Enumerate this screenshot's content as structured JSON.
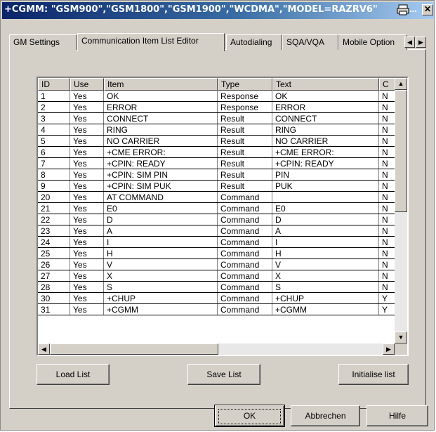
{
  "window": {
    "title": "+CGMM: \"GSM900\",\"GSM1800\",\"GSM1900\",\"WCDMA\",\"MODEL=RAZRV6\"",
    "title_ellipsis": "...",
    "close_glyph": "✕"
  },
  "tabs": [
    {
      "label": "GM Settings"
    },
    {
      "label": "Communication Item List Editor"
    },
    {
      "label": "Autodialing"
    },
    {
      "label": "SQA/VQA"
    },
    {
      "label": "Mobile Option"
    }
  ],
  "active_tab": "Communication Item List Editor",
  "table": {
    "columns": [
      "ID",
      "Use",
      "Item",
      "Type",
      "Text",
      "C"
    ],
    "rows": [
      [
        "1",
        "Yes",
        "OK",
        "Response",
        "OK",
        "N"
      ],
      [
        "2",
        "Yes",
        "ERROR",
        "Response",
        "ERROR",
        "N"
      ],
      [
        "3",
        "Yes",
        "CONNECT",
        "Result",
        "CONNECT",
        "N"
      ],
      [
        "4",
        "Yes",
        "RING",
        "Result",
        "RING",
        "N"
      ],
      [
        "5",
        "Yes",
        "NO CARRIER",
        "Result",
        "NO CARRIER",
        "N"
      ],
      [
        "6",
        "Yes",
        "+CME ERROR:",
        "Result",
        "+CME ERROR:",
        "N"
      ],
      [
        "7",
        "Yes",
        "+CPIN: READY",
        "Result",
        "+CPIN: READY",
        "N"
      ],
      [
        "8",
        "Yes",
        "+CPIN: SIM PIN",
        "Result",
        "PIN",
        "N"
      ],
      [
        "9",
        "Yes",
        "+CPIN: SIM PUK",
        "Result",
        "PUK",
        "N"
      ],
      [
        "20",
        "Yes",
        "AT COMMAND",
        "Command",
        "",
        "N"
      ],
      [
        "21",
        "Yes",
        "E0",
        "Command",
        "E0",
        "N"
      ],
      [
        "22",
        "Yes",
        "D",
        "Command",
        "D",
        "N"
      ],
      [
        "23",
        "Yes",
        "A",
        "Command",
        "A",
        "N"
      ],
      [
        "24",
        "Yes",
        "I",
        "Command",
        "I",
        "N"
      ],
      [
        "25",
        "Yes",
        "H",
        "Command",
        "H",
        "N"
      ],
      [
        "26",
        "Yes",
        "V",
        "Command",
        "V",
        "N"
      ],
      [
        "27",
        "Yes",
        "X",
        "Command",
        "X",
        "N"
      ],
      [
        "28",
        "Yes",
        "S",
        "Command",
        "S",
        "N"
      ],
      [
        "30",
        "Yes",
        "+CHUP",
        "Command",
        "+CHUP",
        "Y"
      ],
      [
        "31",
        "Yes",
        "+CGMM",
        "Command",
        "+CGMM",
        "Y"
      ]
    ]
  },
  "buttons": {
    "load": "Load List",
    "save": "Save List",
    "init": "Initialise list",
    "ok": "OK",
    "cancel": "Abbrechen",
    "help": "Hilfe"
  },
  "scroll_glyphs": {
    "left": "◀",
    "right": "▶",
    "up": "▲",
    "down": "▼"
  }
}
